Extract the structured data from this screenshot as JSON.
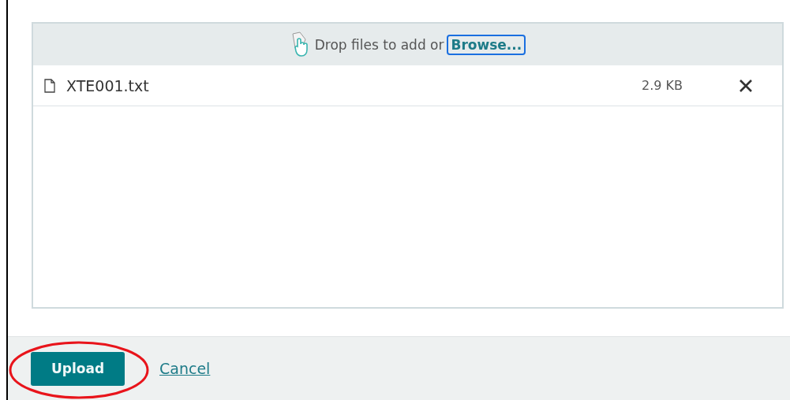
{
  "dropzone": {
    "prompt": "Drop files to add or",
    "browse": "Browse...",
    "browse_focused": true
  },
  "files": [
    {
      "name": "XTE001.txt",
      "size": "2.9 KB"
    }
  ],
  "footer": {
    "primary": "Upload",
    "secondary": "Cancel"
  },
  "annotations": [
    {
      "kind": "ellipse"
    }
  ]
}
